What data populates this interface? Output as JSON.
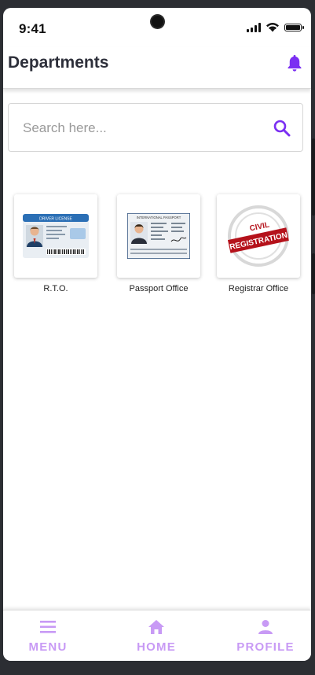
{
  "status_bar": {
    "time": "9:41"
  },
  "app_bar": {
    "title": "Departments",
    "notification_icon": "bell-icon"
  },
  "search": {
    "placeholder": "Search here...",
    "value": ""
  },
  "departments": [
    {
      "label": "R.T.O.",
      "image": "driver-license-card",
      "card_title": "DRIVER LICENSE"
    },
    {
      "label": "Passport Office",
      "image": "international-passport",
      "card_title": "INTERNATIONAL PASSPORT"
    },
    {
      "label": "Registrar Office",
      "image": "civil-registration-stamp",
      "stamp_top": "CIVIL",
      "stamp_bottom": "REGISTRATION"
    }
  ],
  "bottom_nav": [
    {
      "label": "MENU",
      "icon": "menu-icon"
    },
    {
      "label": "HOME",
      "icon": "home-icon"
    },
    {
      "label": "PROFILE",
      "icon": "person-icon"
    }
  ],
  "colors": {
    "accent": "#7b2ff2",
    "nav_inactive": "#c89af5",
    "title": "#2d2f3a"
  }
}
